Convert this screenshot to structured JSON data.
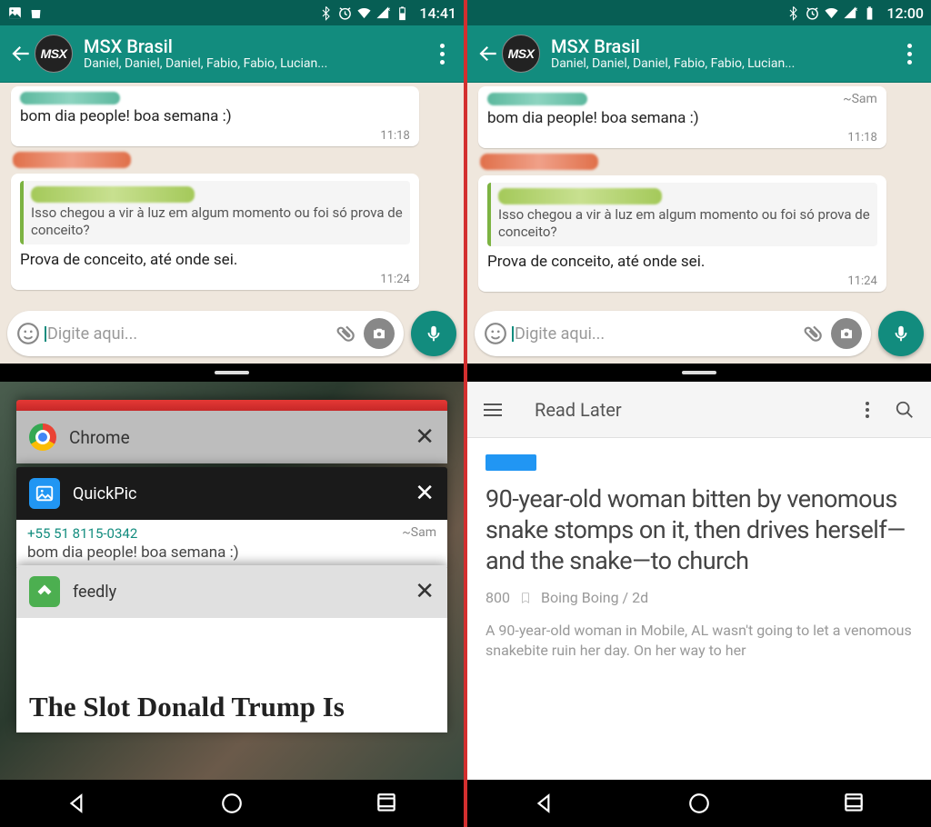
{
  "left": {
    "status": {
      "time": "14:41",
      "show_app_icons": true
    },
    "chat": {
      "title": "MSX Brasil",
      "subtitle": "Daniel, Daniel, Daniel, Fabio, Fabio, Lucian...",
      "avatar_text": "MSX",
      "messages": [
        {
          "sender_tag": "",
          "text": "bom dia people! boa semana :)",
          "time": "11:18"
        },
        {
          "quote": "Isso chegou a vir à luz em algum momento ou foi só prova de conceito?",
          "text": "Prova de conceito, até onde sei.",
          "time": "11:24"
        }
      ],
      "input_placeholder": "Digite aqui..."
    },
    "recents": {
      "cards": [
        {
          "app": "Chrome"
        },
        {
          "app": "QuickPic",
          "preview_line1": "+55 51 8115-0342",
          "preview_tag": "~Sam",
          "preview_line2": "bom dia people! boa semana :)"
        },
        {
          "app": "feedly",
          "article": "The Slot Donald Trump Is"
        }
      ]
    }
  },
  "right": {
    "status": {
      "time": "12:00",
      "show_app_icons": false
    },
    "chat": {
      "title": "MSX Brasil",
      "subtitle": "Daniel, Daniel, Daniel, Fabio, Fabio, Lucian...",
      "avatar_text": "MSX",
      "messages": [
        {
          "sender_tag": "~Sam",
          "text": "bom dia people! boa semana :)",
          "time": "11:18"
        },
        {
          "quote": "Isso chegou a vir à luz em algum momento ou foi só prova de conceito?",
          "text": "Prova de conceito, até onde sei.",
          "time": "11:24"
        }
      ],
      "input_placeholder": "Digite aqui..."
    },
    "feedly": {
      "toolbar_title": "Read Later",
      "headline": "90-year-old woman bitten by venomous snake stomps on it, then drives herself—and the snake—to church",
      "meta_count": "800",
      "meta_source": "Boing Boing / 2d",
      "excerpt": "A 90-year-old woman in Mobile, AL wasn't going to let a venomous snakebite ruin her day. On her way to her"
    }
  }
}
